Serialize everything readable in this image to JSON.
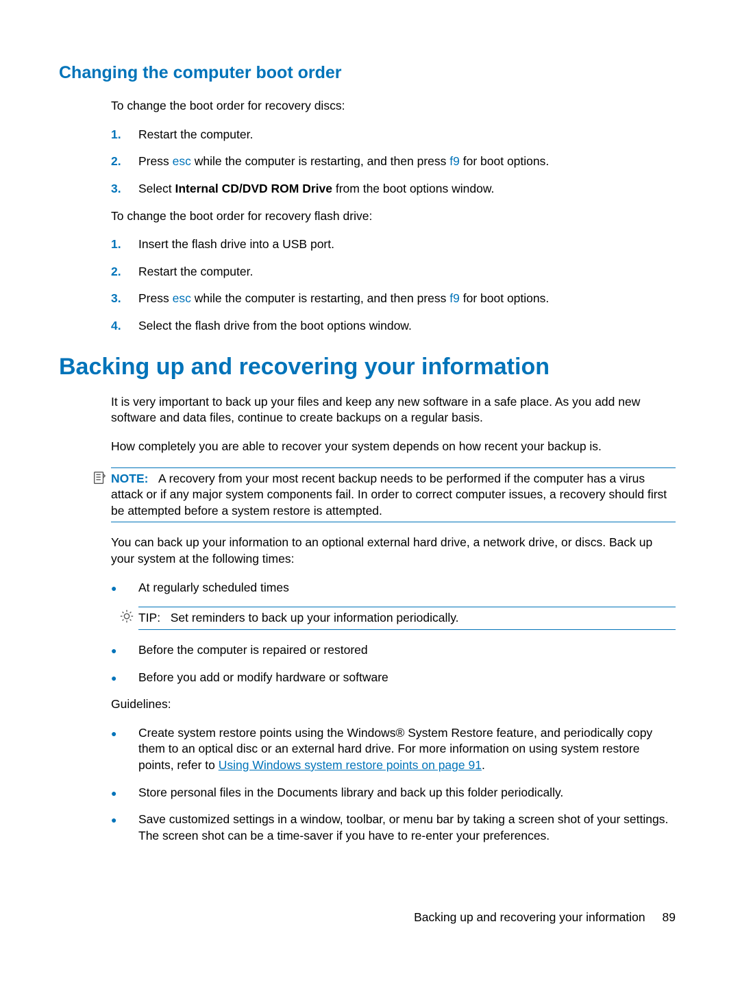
{
  "section1": {
    "heading": "Changing the computer boot order",
    "intro1": "To change the boot order for recovery discs:",
    "list1": {
      "n1": "1.",
      "i1": "Restart the computer.",
      "n2": "2.",
      "i2a": "Press ",
      "i2_key1": "esc",
      "i2b": " while the computer is restarting, and then press ",
      "i2_key2": "f9",
      "i2c": " for boot options.",
      "n3": "3.",
      "i3a": "Select ",
      "i3_bold": "Internal CD/DVD ROM Drive",
      "i3b": " from the boot options window."
    },
    "intro2": "To change the boot order for recovery flash drive:",
    "list2": {
      "n1": "1.",
      "i1": "Insert the flash drive into a USB port.",
      "n2": "2.",
      "i2": "Restart the computer.",
      "n3": "3.",
      "i3a": "Press ",
      "i3_key1": "esc",
      "i3b": " while the computer is restarting, and then press ",
      "i3_key2": "f9",
      "i3c": " for boot options.",
      "n4": "4.",
      "i4": "Select the flash drive from the boot options window."
    }
  },
  "section2": {
    "heading": "Backing up and recovering your information",
    "p1": "It is very important to back up your files and keep any new software in a safe place. As you add new software and data files, continue to create backups on a regular basis.",
    "p2": "How completely you are able to recover your system depends on how recent your backup is.",
    "note": {
      "label": "NOTE:",
      "body": "A recovery from your most recent backup needs to be performed if the computer has a virus attack or if any major system components fail. In order to correct computer issues, a recovery should first be attempted before a system restore is attempted."
    },
    "p3": "You can back up your information to an optional external hard drive, a network drive, or discs. Back up your system at the following times:",
    "bullets1": {
      "b1": "At regularly scheduled times"
    },
    "tip": {
      "label": "TIP:",
      "body": "Set reminders to back up your information periodically."
    },
    "bullets2": {
      "b1": "Before the computer is repaired or restored",
      "b2": "Before you add or modify hardware or software"
    },
    "p4": "Guidelines:",
    "bullets3": {
      "b1a": "Create system restore points using the Windows® System Restore feature, and periodically copy them to an optical disc or an external hard drive. For more information on using system restore points, refer to ",
      "b1_link": "Using Windows system restore points on page 91",
      "b1b": ".",
      "b2": "Store personal files in the Documents library and back up this folder periodically.",
      "b3": "Save customized settings in a window, toolbar, or menu bar by taking a screen shot of your settings. The screen shot can be a time-saver if you have to re-enter your preferences."
    }
  },
  "footer": {
    "text": "Backing up and recovering your information",
    "page": "89"
  }
}
